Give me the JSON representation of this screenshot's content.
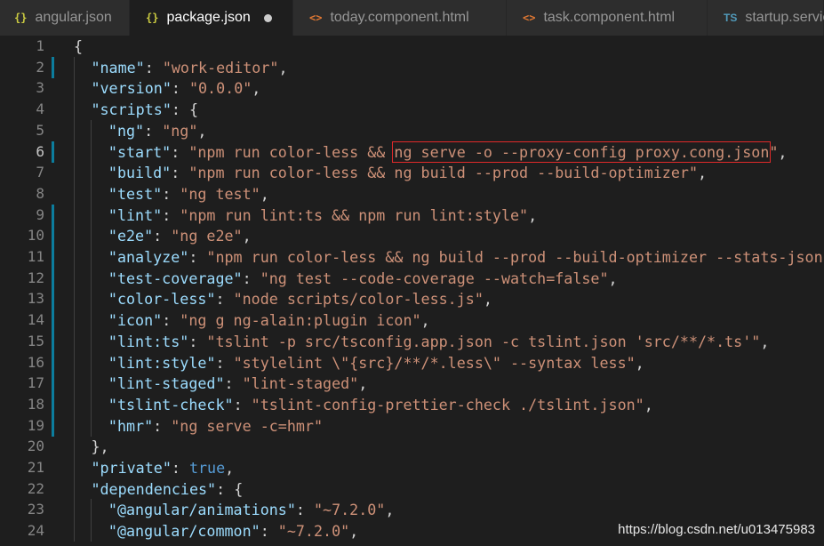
{
  "tabs": [
    {
      "label": "angular.json",
      "icon": "{}",
      "icon_name": "json-file-icon",
      "active": false,
      "dirty": false
    },
    {
      "label": "package.json",
      "icon": "{}",
      "icon_name": "json-file-icon",
      "active": true,
      "dirty": true
    },
    {
      "label": "today.component.html",
      "icon": "<>",
      "icon_name": "html-file-icon",
      "active": false,
      "dirty": false
    },
    {
      "label": "task.component.html",
      "icon": "<>",
      "icon_name": "html-file-icon",
      "active": false,
      "dirty": false
    },
    {
      "label": "startup.service.ts",
      "icon": "TS",
      "icon_name": "typescript-file-icon",
      "active": false,
      "dirty": false
    }
  ],
  "editor": {
    "current_line": 6,
    "lines": [
      {
        "n": "1",
        "indent": 0,
        "parts": [
          [
            "p",
            "{"
          ]
        ]
      },
      {
        "n": "2",
        "indent": 1,
        "changed": true,
        "parts": [
          [
            "k",
            "\"name\""
          ],
          [
            "p",
            ": "
          ],
          [
            "s",
            "\"work-editor\""
          ],
          [
            "p",
            ","
          ]
        ]
      },
      {
        "n": "3",
        "indent": 1,
        "parts": [
          [
            "k",
            "\"version\""
          ],
          [
            "p",
            ": "
          ],
          [
            "s",
            "\"0.0.0\""
          ],
          [
            "p",
            ","
          ]
        ]
      },
      {
        "n": "4",
        "indent": 1,
        "parts": [
          [
            "k",
            "\"scripts\""
          ],
          [
            "p",
            ": {"
          ]
        ]
      },
      {
        "n": "5",
        "indent": 2,
        "parts": [
          [
            "k",
            "\"ng\""
          ],
          [
            "p",
            ": "
          ],
          [
            "s",
            "\"ng\""
          ],
          [
            "p",
            ","
          ]
        ]
      },
      {
        "n": "6",
        "indent": 2,
        "changed": true,
        "parts": [
          [
            "k",
            "\"start\""
          ],
          [
            "p",
            ": "
          ],
          [
            "s",
            "\"npm run color-less && "
          ],
          [
            "s",
            "ng serve -o --proxy-config proxy.cong.json",
            "hl"
          ],
          [
            "s",
            "\""
          ],
          [
            "p",
            ","
          ]
        ]
      },
      {
        "n": "7",
        "indent": 2,
        "parts": [
          [
            "k",
            "\"build\""
          ],
          [
            "p",
            ": "
          ],
          [
            "s",
            "\"npm run color-less && ng build --prod --build-optimizer\""
          ],
          [
            "p",
            ","
          ]
        ]
      },
      {
        "n": "8",
        "indent": 2,
        "parts": [
          [
            "k",
            "\"test\""
          ],
          [
            "p",
            ": "
          ],
          [
            "s",
            "\"ng test\""
          ],
          [
            "p",
            ","
          ]
        ]
      },
      {
        "n": "9",
        "indent": 2,
        "changed": true,
        "parts": [
          [
            "k",
            "\"lint\""
          ],
          [
            "p",
            ": "
          ],
          [
            "s",
            "\"npm run lint:ts && npm run lint:style\""
          ],
          [
            "p",
            ","
          ]
        ]
      },
      {
        "n": "10",
        "indent": 2,
        "changed": true,
        "parts": [
          [
            "k",
            "\"e2e\""
          ],
          [
            "p",
            ": "
          ],
          [
            "s",
            "\"ng e2e\""
          ],
          [
            "p",
            ","
          ]
        ]
      },
      {
        "n": "11",
        "indent": 2,
        "changed": true,
        "parts": [
          [
            "k",
            "\"analyze\""
          ],
          [
            "p",
            ": "
          ],
          [
            "s",
            "\"npm run color-less && ng build --prod --build-optimizer --stats-json\""
          ],
          [
            "p",
            ","
          ]
        ]
      },
      {
        "n": "12",
        "indent": 2,
        "changed": true,
        "parts": [
          [
            "k",
            "\"test-coverage\""
          ],
          [
            "p",
            ": "
          ],
          [
            "s",
            "\"ng test --code-coverage --watch=false\""
          ],
          [
            "p",
            ","
          ]
        ]
      },
      {
        "n": "13",
        "indent": 2,
        "changed": true,
        "parts": [
          [
            "k",
            "\"color-less\""
          ],
          [
            "p",
            ": "
          ],
          [
            "s",
            "\"node scripts/color-less.js\""
          ],
          [
            "p",
            ","
          ]
        ]
      },
      {
        "n": "14",
        "indent": 2,
        "changed": true,
        "parts": [
          [
            "k",
            "\"icon\""
          ],
          [
            "p",
            ": "
          ],
          [
            "s",
            "\"ng g ng-alain:plugin icon\""
          ],
          [
            "p",
            ","
          ]
        ]
      },
      {
        "n": "15",
        "indent": 2,
        "changed": true,
        "parts": [
          [
            "k",
            "\"lint:ts\""
          ],
          [
            "p",
            ": "
          ],
          [
            "s",
            "\"tslint -p src/tsconfig.app.json -c tslint.json 'src/**/*.ts'\""
          ],
          [
            "p",
            ","
          ]
        ]
      },
      {
        "n": "16",
        "indent": 2,
        "changed": true,
        "parts": [
          [
            "k",
            "\"lint:style\""
          ],
          [
            "p",
            ": "
          ],
          [
            "s",
            "\"stylelint \\\"{src}/**/*.less\\\" --syntax less\""
          ],
          [
            "p",
            ","
          ]
        ]
      },
      {
        "n": "17",
        "indent": 2,
        "changed": true,
        "parts": [
          [
            "k",
            "\"lint-staged\""
          ],
          [
            "p",
            ": "
          ],
          [
            "s",
            "\"lint-staged\""
          ],
          [
            "p",
            ","
          ]
        ]
      },
      {
        "n": "18",
        "indent": 2,
        "changed": true,
        "parts": [
          [
            "k",
            "\"tslint-check\""
          ],
          [
            "p",
            ": "
          ],
          [
            "s",
            "\"tslint-config-prettier-check ./tslint.json\""
          ],
          [
            "p",
            ","
          ]
        ]
      },
      {
        "n": "19",
        "indent": 2,
        "changed": true,
        "parts": [
          [
            "k",
            "\"hmr\""
          ],
          [
            "p",
            ": "
          ],
          [
            "s",
            "\"ng serve -c=hmr\""
          ]
        ]
      },
      {
        "n": "20",
        "indent": 1,
        "parts": [
          [
            "p",
            "},"
          ]
        ]
      },
      {
        "n": "21",
        "indent": 1,
        "parts": [
          [
            "k",
            "\"private\""
          ],
          [
            "p",
            ": "
          ],
          [
            "b",
            "true"
          ],
          [
            "p",
            ","
          ]
        ]
      },
      {
        "n": "22",
        "indent": 1,
        "parts": [
          [
            "k",
            "\"dependencies\""
          ],
          [
            "p",
            ": {"
          ]
        ]
      },
      {
        "n": "23",
        "indent": 2,
        "parts": [
          [
            "k",
            "\"@angular/animations\""
          ],
          [
            "p",
            ": "
          ],
          [
            "s",
            "\"~7.2.0\""
          ],
          [
            "p",
            ","
          ]
        ]
      },
      {
        "n": "24",
        "indent": 2,
        "parts": [
          [
            "k",
            "\"@angular/common\""
          ],
          [
            "p",
            ": "
          ],
          [
            "s",
            "\"~7.2.0\""
          ],
          [
            "p",
            ","
          ]
        ]
      }
    ]
  },
  "watermark": "https://blog.csdn.net/u013475983",
  "colors": {
    "key": "#9cdcfe",
    "string": "#ce9178",
    "boolean": "#569cd6",
    "highlight_box": "#e02a2a",
    "git_modified": "#0c7d9d"
  }
}
